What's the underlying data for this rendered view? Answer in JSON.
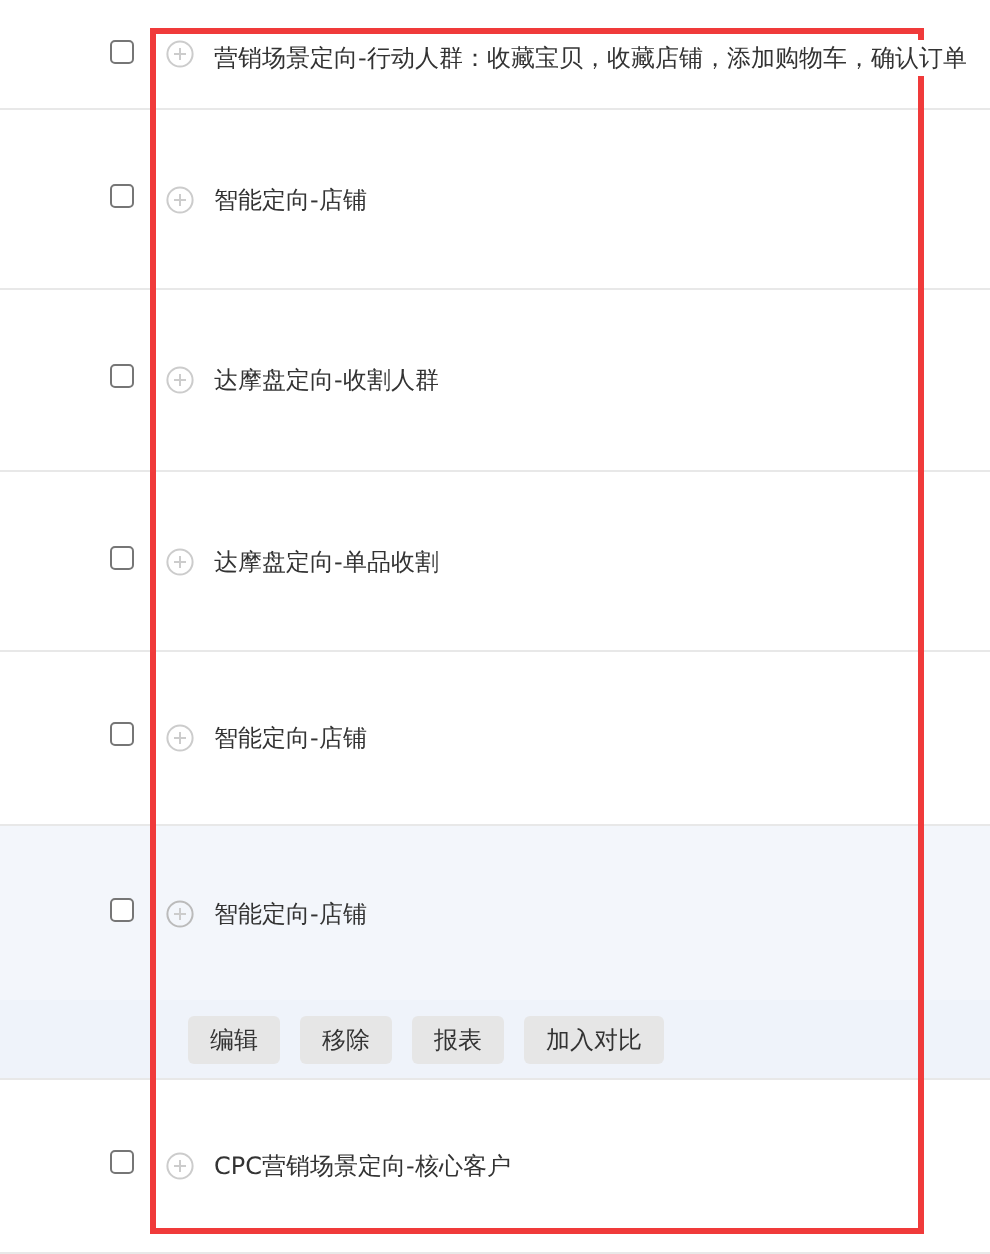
{
  "rows": [
    {
      "label": "营销场景定向-行动人群：收藏宝贝，收藏店铺，添加购物车，确认订单",
      "checked": false,
      "expanded": false
    },
    {
      "label": "智能定向-店铺",
      "checked": false,
      "expanded": false
    },
    {
      "label": "达摩盘定向-收割人群",
      "checked": false,
      "expanded": false
    },
    {
      "label": "达摩盘定向-单品收割",
      "checked": false,
      "expanded": false
    },
    {
      "label": "智能定向-店铺",
      "checked": false,
      "expanded": false
    },
    {
      "label": "智能定向-店铺",
      "checked": false,
      "expanded": true,
      "actions": [
        "编辑",
        "移除",
        "报表",
        "加入对比"
      ]
    },
    {
      "label": "CPC营销场景定向-核心客户",
      "checked": false,
      "expanded": false
    }
  ],
  "highlight_frame": {
    "color": "#f03a3a"
  }
}
